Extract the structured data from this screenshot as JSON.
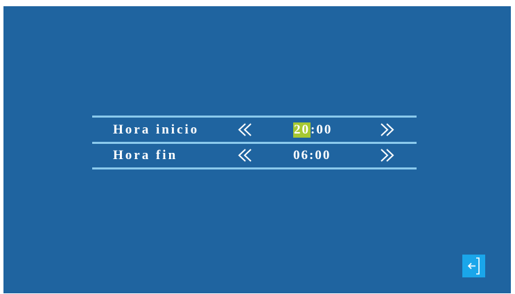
{
  "time_settings": {
    "rows": [
      {
        "label": "Hora inicio",
        "hour": "20",
        "separator": ":",
        "minute": "00",
        "selected_segment": "hour"
      },
      {
        "label": "Hora fin",
        "hour": "06",
        "separator": ":",
        "minute": "00",
        "selected_segment": null
      }
    ],
    "decrement_icon": "double-chevron-left-icon",
    "increment_icon": "double-chevron-right-icon"
  },
  "exit": {
    "icon": "exit-arrow-icon"
  },
  "colors": {
    "background": "#1f64a0",
    "divider": "#8ac9ec",
    "selection_highlight": "#a6c832",
    "exit_button": "#1aa6ea",
    "text": "#ffffff"
  }
}
